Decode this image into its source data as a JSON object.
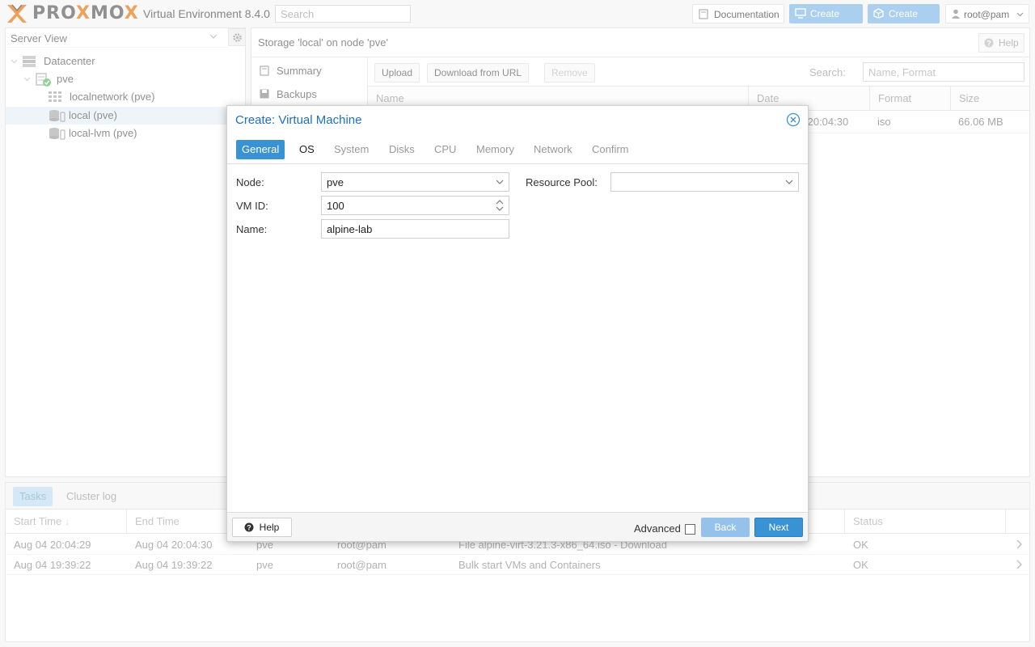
{
  "app": {
    "logo_text": "PROXMOX",
    "version_label": "Virtual Environment 8.4.0",
    "search_placeholder": "Search",
    "buttons": {
      "documentation": "Documentation",
      "create_vm": "Create VM",
      "create_ct": "Create CT",
      "user": "root@pam"
    }
  },
  "sidebar": {
    "view": "Server View",
    "tree": [
      {
        "label": "Datacenter",
        "icon": "datacenter-icon"
      },
      {
        "label": "pve",
        "icon": "node-icon"
      },
      {
        "label": "localnetwork (pve)",
        "icon": "network-grid-icon"
      },
      {
        "label": "local (pve)",
        "icon": "storage-icon"
      },
      {
        "label": "local-lvm (pve)",
        "icon": "storage-icon"
      }
    ]
  },
  "main": {
    "title": "Storage 'local' on node 'pve'",
    "help": "Help",
    "nav": [
      "Summary",
      "Backups"
    ],
    "toolbar": {
      "upload": "Upload",
      "download_url": "Download from URL",
      "remove": "Remove",
      "search_label": "Search:",
      "search_placeholder": "Name, Format"
    },
    "columns": [
      "Name",
      "Date",
      "Format",
      "Size"
    ],
    "row": {
      "date_partial": ":20:04:30",
      "format": "iso",
      "size": "66.06 MB"
    }
  },
  "tasks": {
    "tabs": [
      "Tasks",
      "Cluster log"
    ],
    "columns": [
      "Start Time",
      "End Time",
      "Status"
    ],
    "rows": [
      {
        "start": "Aug 04 20:04:29",
        "end": "Aug 04 20:04:30",
        "node": "pve",
        "user": "root@pam",
        "desc": "File alpine-virt-3.21.3-x86_64.iso - Download",
        "status": "OK"
      },
      {
        "start": "Aug 04 19:39:22",
        "end": "Aug 04 19:39:22",
        "node": "pve",
        "user": "root@pam",
        "desc": "Bulk start VMs and Containers",
        "status": "OK"
      }
    ]
  },
  "modal": {
    "title": "Create: Virtual Machine",
    "tabs": [
      "General",
      "OS",
      "System",
      "Disks",
      "CPU",
      "Memory",
      "Network",
      "Confirm"
    ],
    "fields": {
      "node_label": "Node:",
      "node_value": "pve",
      "vmid_label": "VM ID:",
      "vmid_value": "100",
      "name_label": "Name:",
      "name_value": "alpine-lab",
      "pool_label": "Resource Pool:",
      "pool_value": ""
    },
    "footer": {
      "help": "Help",
      "advanced": "Advanced",
      "back": "Back",
      "next": "Next"
    }
  },
  "colors": {
    "accent": "#3892d4",
    "title_blue": "#1f6fbf",
    "logo_orange": "#e57000"
  }
}
